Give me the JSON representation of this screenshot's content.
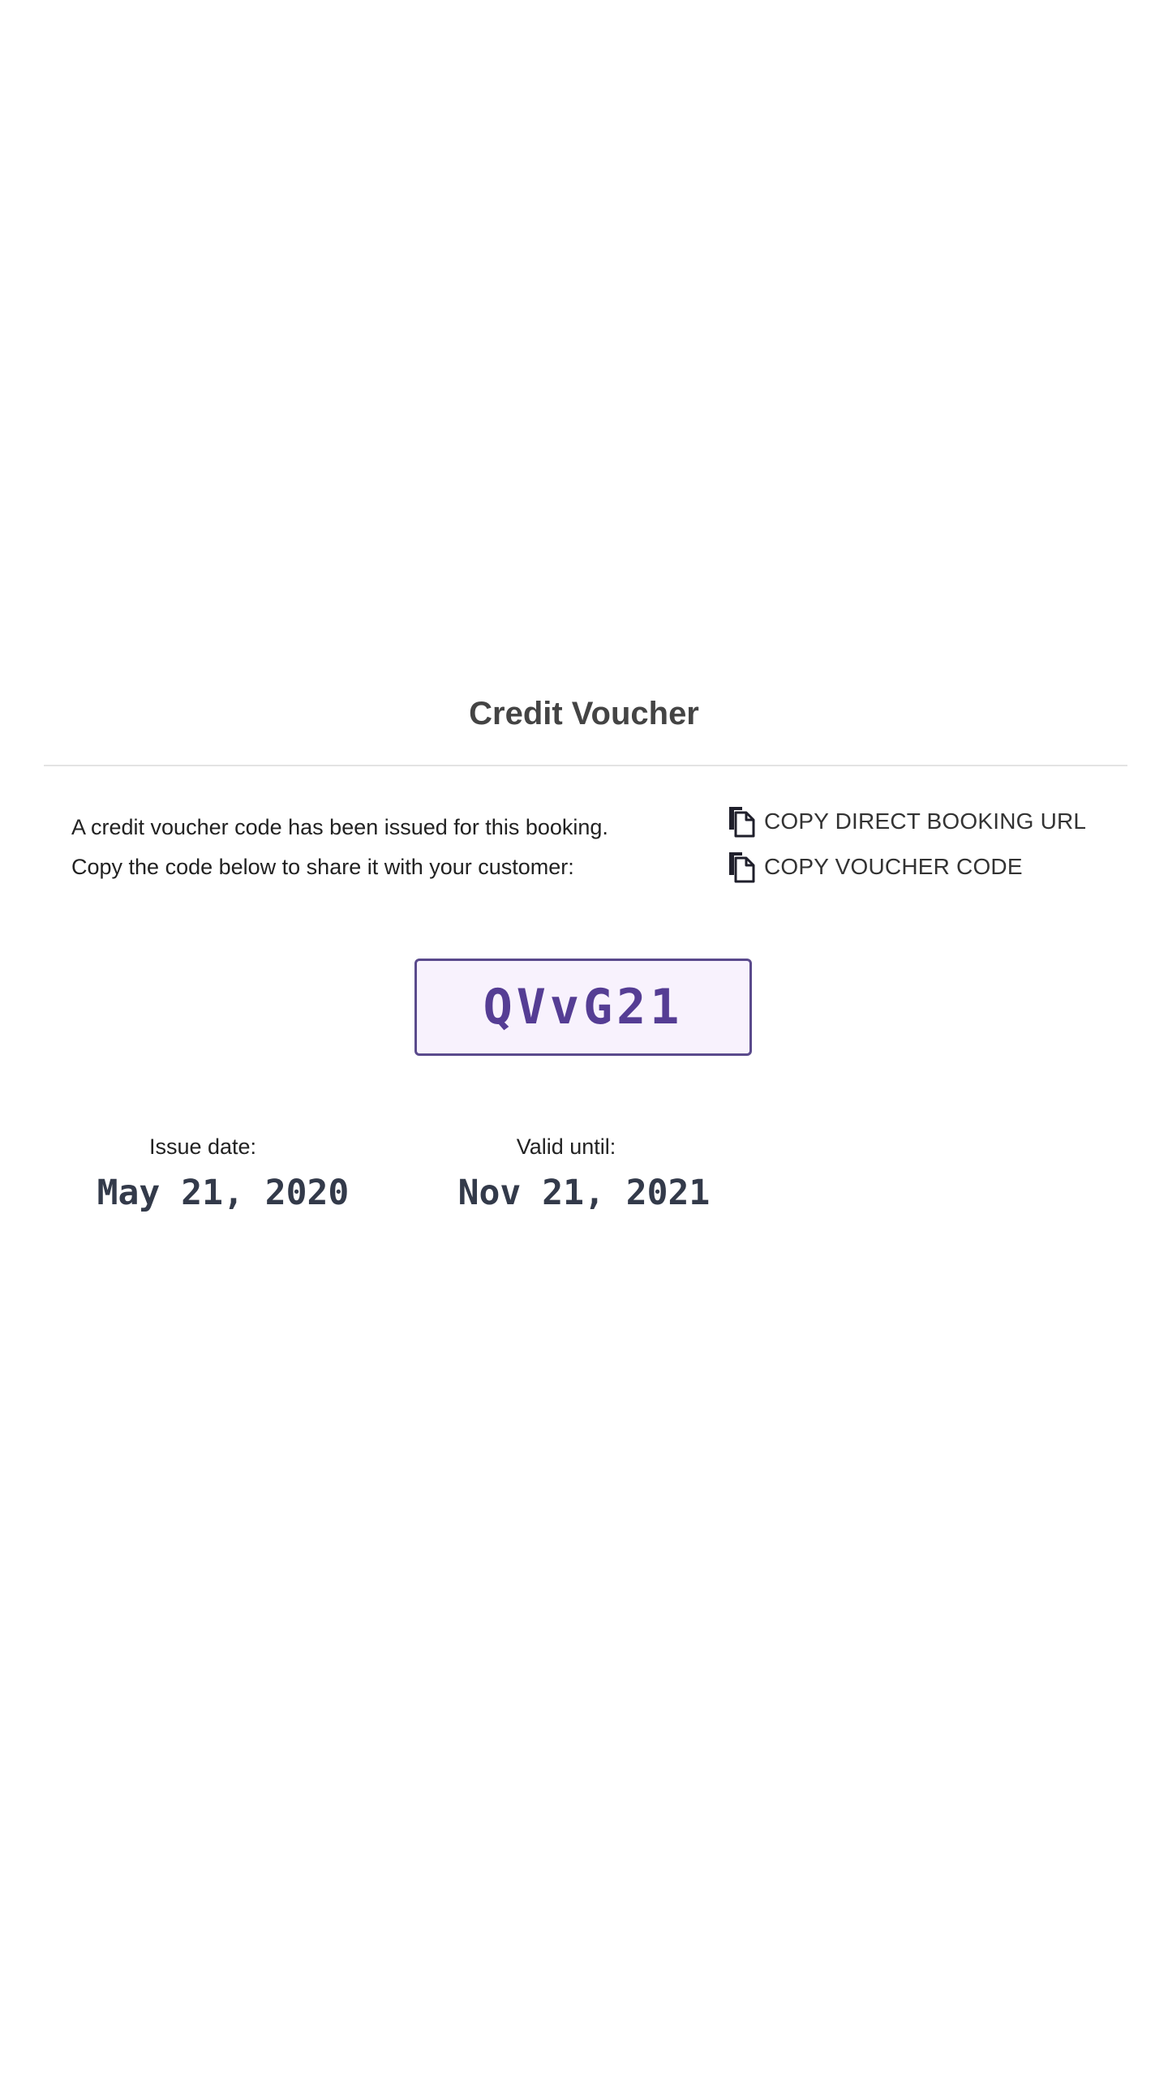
{
  "voucher": {
    "title": "Credit Voucher",
    "description_line1": "A credit voucher code has been issued for this booking.",
    "description_line2": "Copy the code below to share it with your customer:",
    "actions": {
      "copy_url_label": "COPY DIRECT BOOKING URL",
      "copy_code_label": "COPY VOUCHER CODE",
      "icon": "copy-icon"
    },
    "code": "QVvG21",
    "issue_date_label": "Issue date:",
    "issue_date": "May 21, 2020",
    "valid_until_label": "Valid until:",
    "valid_until": "Nov 21, 2021"
  },
  "colors": {
    "accent": "#553d94",
    "code_border": "#5a4a8c",
    "code_background": "#f8f2fd",
    "title": "#444444"
  }
}
